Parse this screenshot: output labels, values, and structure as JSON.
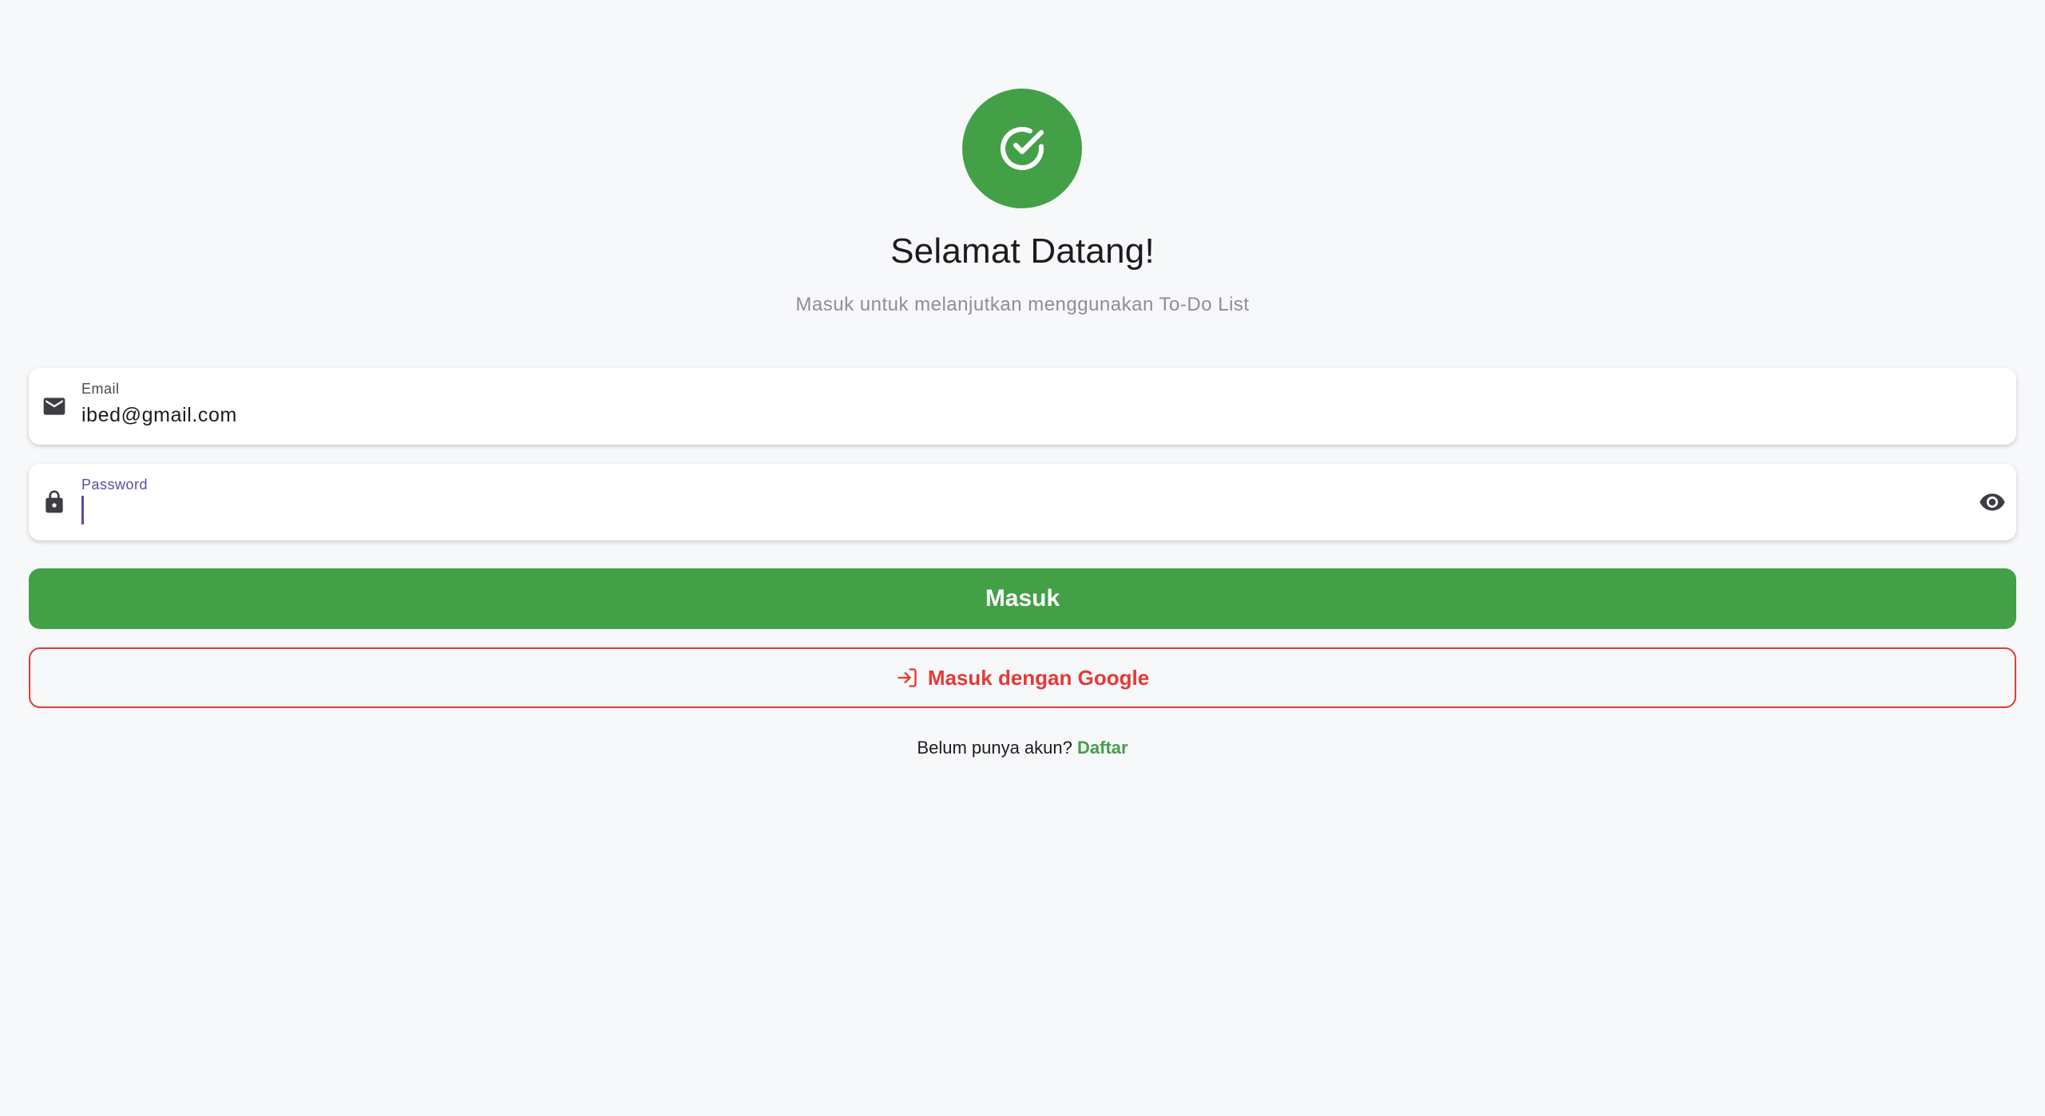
{
  "header": {
    "logo_icon": "check-circle-icon",
    "title": "Selamat Datang!",
    "subtitle": "Masuk untuk melanjutkan menggunakan To-Do List"
  },
  "form": {
    "email": {
      "label": "Email",
      "value": "ibed@gmail.com",
      "icon": "mail-icon"
    },
    "password": {
      "label": "Password",
      "value": "",
      "icon": "lock-icon",
      "toggle_icon": "eye-icon"
    },
    "submit_label": "Masuk",
    "google_label": "Masuk dengan Google",
    "google_icon": "login-icon"
  },
  "footer": {
    "prompt": "Belum punya akun?",
    "register_label": "Daftar"
  },
  "colors": {
    "primary": "#43a047",
    "danger": "#e53935",
    "accent": "#5e4aa6",
    "background": "#f7f8fa"
  }
}
